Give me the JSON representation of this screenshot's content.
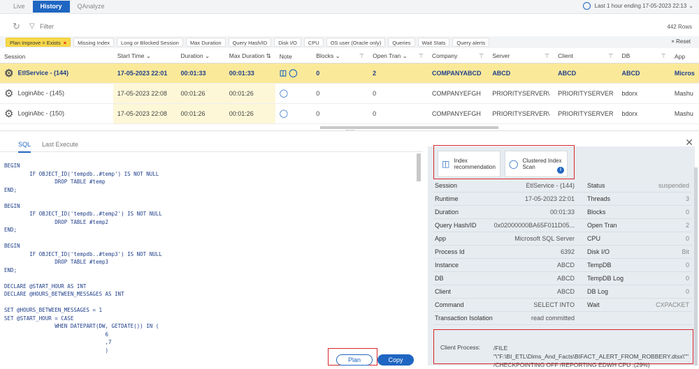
{
  "tabs": [
    "Live",
    "History",
    "QAnalyze"
  ],
  "time_range": "Last 1 hour ending 17-05-2023 22:13",
  "filter_label": "Filter",
  "row_count": "442 Rows",
  "chips": [
    "Plan Improve = Exists",
    "Missing Index",
    "Long or Blocked Session",
    "Max Duration",
    "Query Hash/ID",
    "Disk I/O",
    "CPU",
    "OS user (Oracle only)",
    "Queries",
    "Wait Stats",
    "Query alerts"
  ],
  "reset_label": "Reset",
  "columns": [
    "Session",
    "Start Time",
    "Duration",
    "Max Duration",
    "Note",
    "Blocks",
    "Open Tran",
    "Company",
    "Server",
    "Client",
    "DB",
    "App"
  ],
  "rows": [
    {
      "session": "EtlService - (144)",
      "start": "17-05-2023 22:01",
      "duration": "00:01:33",
      "maxdur": "00:01:33",
      "blocks": "0",
      "opentran": "2",
      "company": "COMPANYABCD",
      "server": "ABCD",
      "client": "ABCD",
      "db": "ABCD",
      "app": "Micros"
    },
    {
      "session": "LoginAbc - (145)",
      "start": "17-05-2023 22:08",
      "duration": "00:01:26",
      "maxdur": "00:01:26",
      "blocks": "0",
      "opentran": "0",
      "company": "COMPANYEFGH",
      "server": "PRIORITYSERVER\\",
      "client": "PRIORITYSERVER",
      "db": "bdorx",
      "app": "Mashu"
    },
    {
      "session": "LoginAbc - (150)",
      "start": "17-05-2023 22:08",
      "duration": "00:01:26",
      "maxdur": "00:01:26",
      "blocks": "0",
      "opentran": "0",
      "company": "COMPANYEFGH",
      "server": "PRIORITYSERVER\\",
      "client": "PRIORITYSERVER",
      "db": "bdorx",
      "app": "Mashu"
    }
  ],
  "sql_tabs": [
    "SQL",
    "Last Execute"
  ],
  "sql_code": "BEGIN\n        IF OBJECT_ID('tempdb..#temp') IS NOT NULL\n                DROP TABLE #temp\nEND;\n\nBEGIN\n        IF OBJECT_ID('tempdb..#temp2') IS NOT NULL\n                DROP TABLE #temp2\nEND;\n\nBEGIN\n        IF OBJECT_ID('tempdb..#temp3') IS NOT NULL\n                DROP TABLE #temp3\nEND;\n\nDECLARE @START_HOUR AS INT\nDECLARE @HOURS_BETWEEN_MESSAGES AS INT\n\nSET @HOURS_BETWEEN_MESSAGES = 1\nSET @START_HOUR = CASE\n                WHEN DATEPART(DW, GETDATE()) IN (\n                                6\n                                ,7\n                                )",
  "plan_label": "Plan",
  "copy_label": "Copy",
  "tiles": [
    "Index recommendation",
    "Clustered Index Scan"
  ],
  "props_left": [
    [
      "Session",
      "EtlService - (144)"
    ],
    [
      "Runtime",
      "17-05-2023 22:01"
    ],
    [
      "Duration",
      "00:01:33"
    ],
    [
      "Query Hash/ID",
      "0x02000000BA65F011D05..."
    ],
    [
      "App",
      "Microsoft SQL Server"
    ],
    [
      "Process Id",
      "6392"
    ],
    [
      "Instance",
      "ABCD"
    ],
    [
      "DB",
      "ABCD"
    ],
    [
      "Client",
      "ABCD"
    ],
    [
      "Command",
      "SELECT INTO"
    ],
    [
      "Transaction Isolation",
      "read committed"
    ]
  ],
  "props_right": [
    [
      "Status",
      "suspended"
    ],
    [
      "Threads",
      "3"
    ],
    [
      "Blocks",
      "0"
    ],
    [
      "Open Tran",
      "2"
    ],
    [
      "CPU",
      "0"
    ],
    [
      "Disk I/O",
      "Bit"
    ],
    [
      "TempDB",
      "0"
    ],
    [
      "TempDB Log",
      "0"
    ],
    [
      "DB Log",
      "0"
    ],
    [
      "Wait",
      "CXPACKET"
    ],
    [
      "",
      ""
    ]
  ],
  "client_process_label": "Client Process:",
  "client_process_value": "/FILE \"\\\"F:\\BI_ETL\\Dims_And_Facts\\BIFACT_ALERT_FROM_ROBBERY.dtsx\\\"\" /CHECKPOINTING OFF /REPORTING EDWH CPU :(29%)"
}
